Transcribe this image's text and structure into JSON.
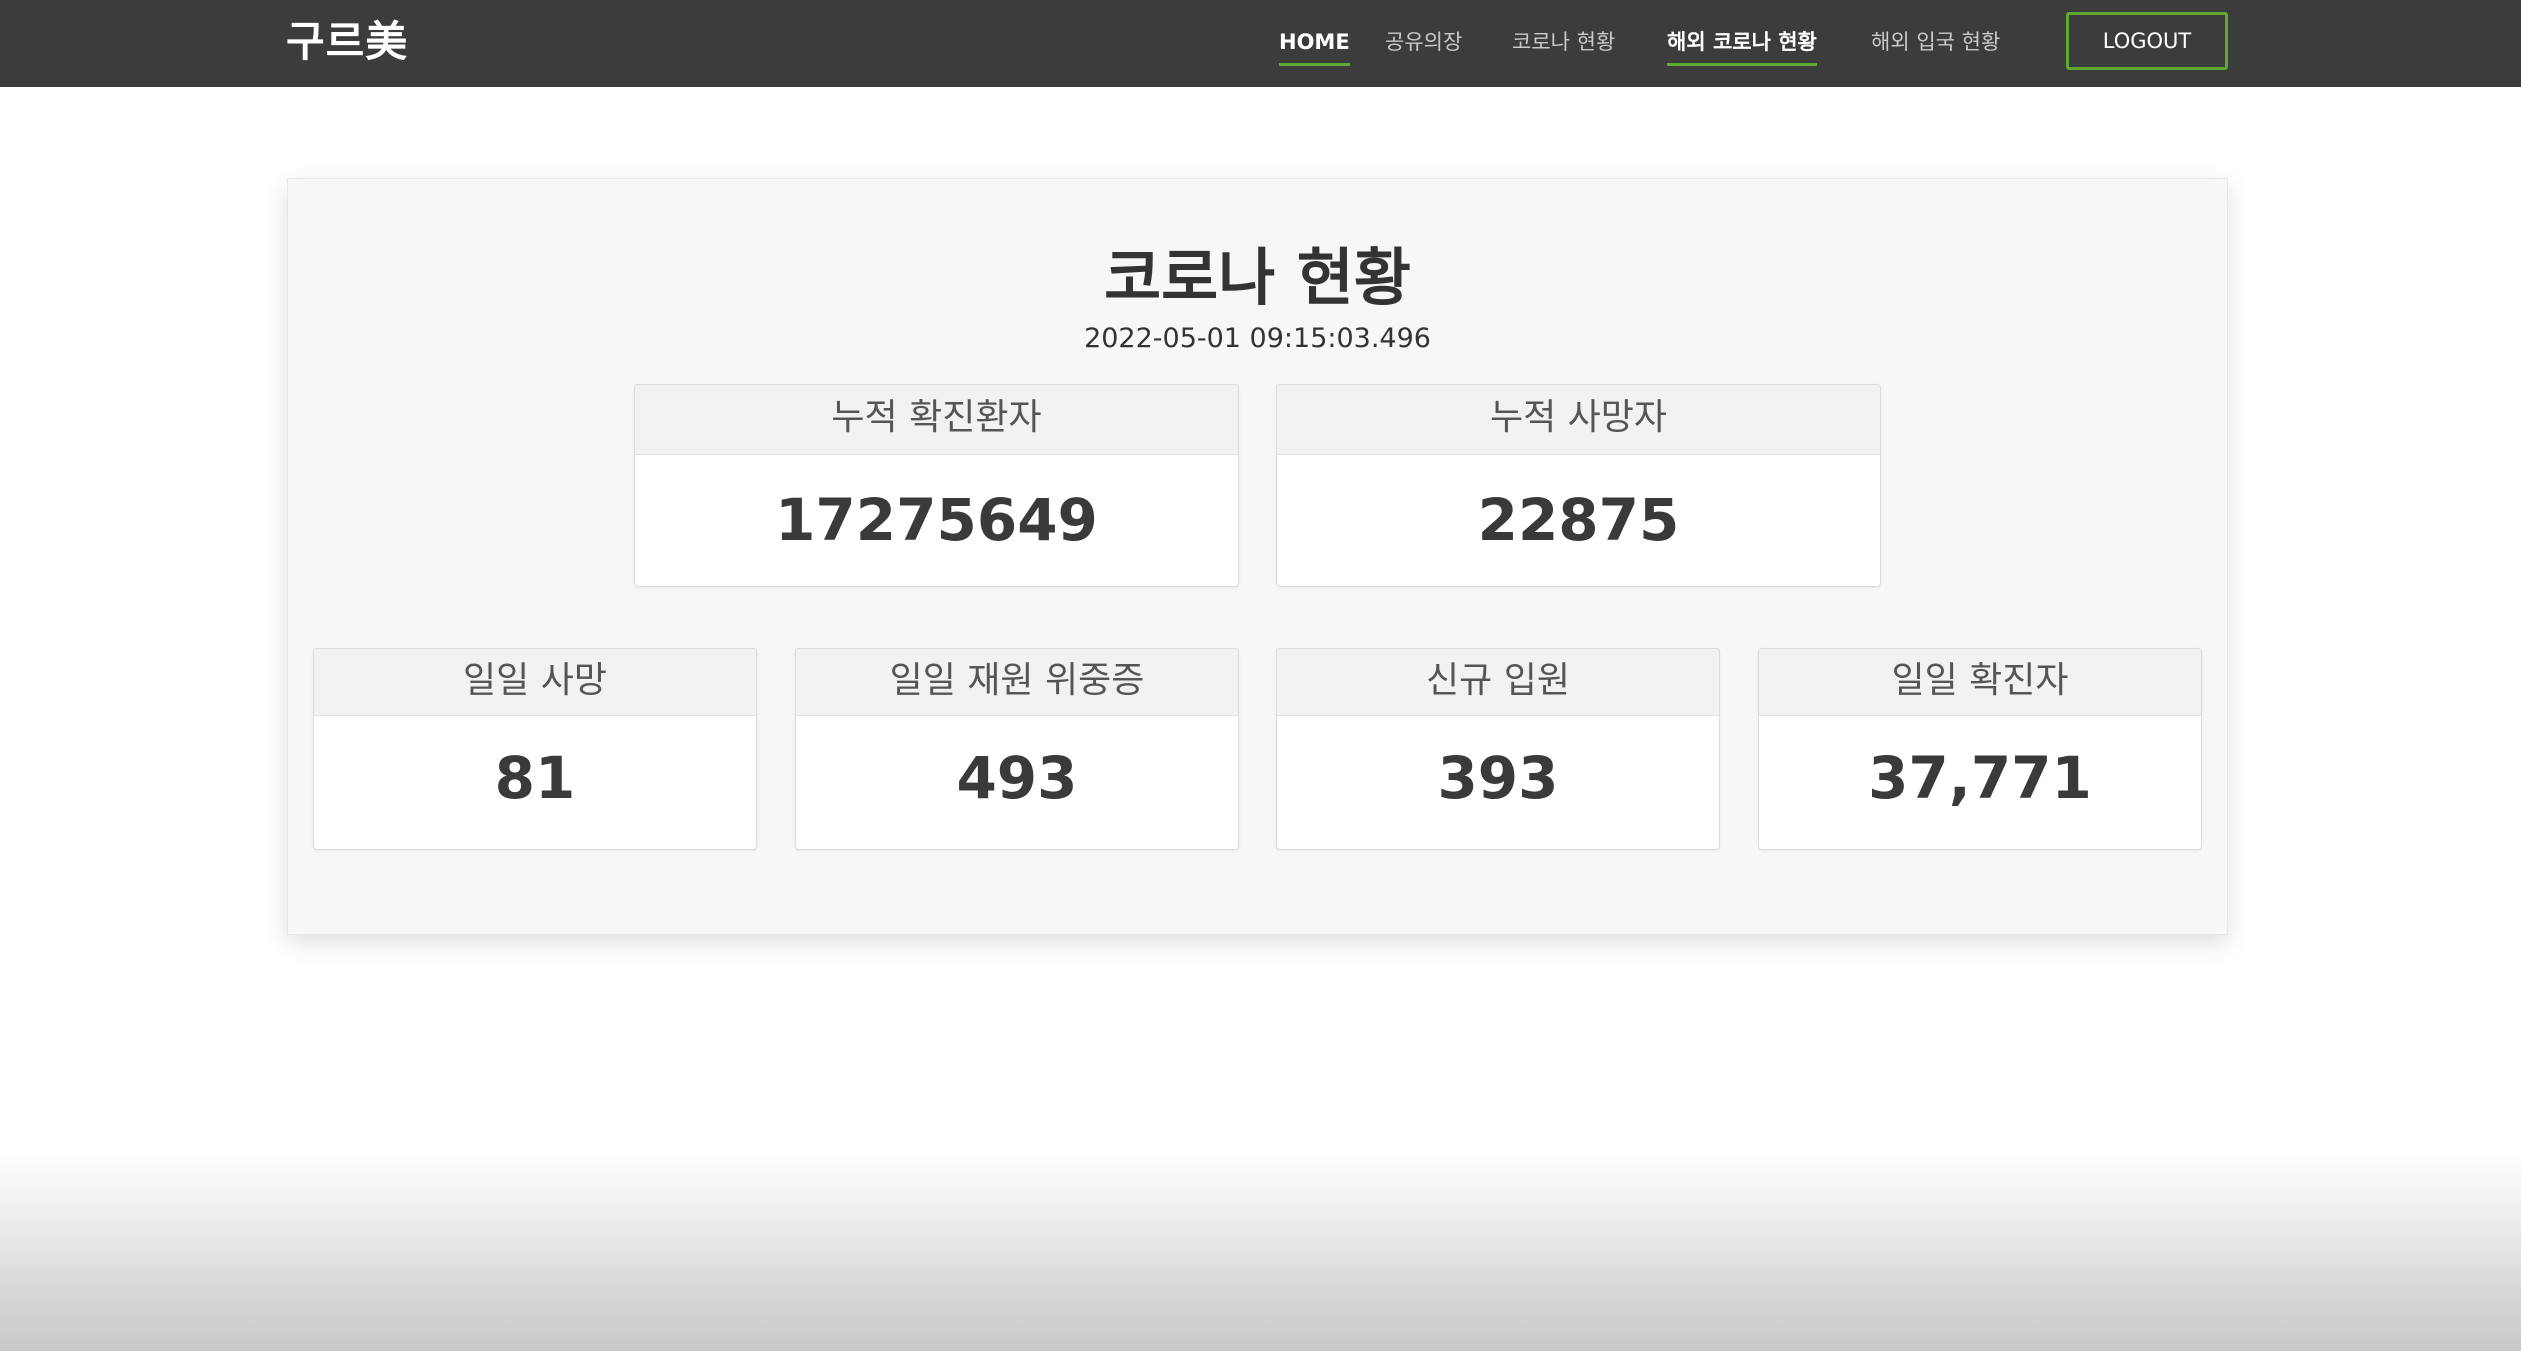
{
  "navbar": {
    "brand": "구르美",
    "links": [
      {
        "label": "HOME"
      },
      {
        "label": "공유의장"
      },
      {
        "label": "코로나 현황"
      },
      {
        "label": "해외 코로나 현황"
      },
      {
        "label": "해외 입국 현황"
      }
    ],
    "logout_label": "LOGOUT"
  },
  "main": {
    "title": "코로나 현황",
    "timestamp": "2022-05-01 09:15:03.496",
    "summary_cards": [
      {
        "label": "누적 확진환자",
        "value": "17275649"
      },
      {
        "label": "누적 사망자",
        "value": "22875"
      }
    ],
    "daily_cards": [
      {
        "label": "일일 사망",
        "value": "81"
      },
      {
        "label": "일일 재원 위중증",
        "value": "493"
      },
      {
        "label": "신규 입원",
        "value": "393"
      },
      {
        "label": "일일 확진자",
        "value": "37,771"
      }
    ]
  },
  "colors": {
    "navbar_bg": "#3c3c3c",
    "accent_green": "#5fa832",
    "panel_bg": "#f7f7f8"
  }
}
